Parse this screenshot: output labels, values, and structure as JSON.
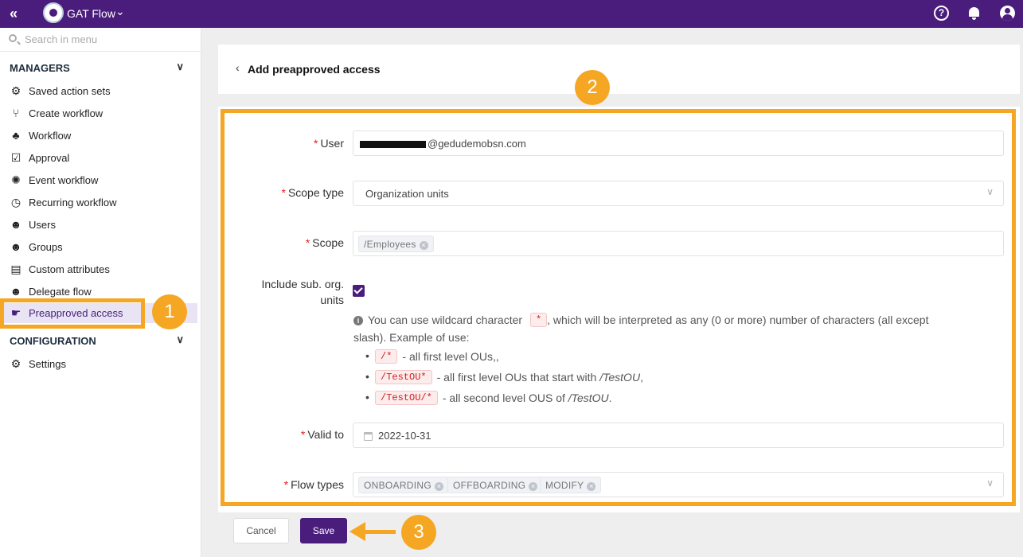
{
  "topbar": {
    "app_title": "GAT Flow",
    "collapse_icon": "double-chevron-left",
    "icons": [
      "help-icon",
      "bell-icon",
      "user-icon"
    ],
    "color": "#4a1d7d"
  },
  "sidebar": {
    "search_placeholder": "Search in menu",
    "managers_label": "MANAGERS",
    "configuration_label": "CONFIGURATION",
    "items": [
      {
        "label": "Saved action sets",
        "icon": "gears-icon"
      },
      {
        "label": "Create workflow",
        "icon": "branch-icon"
      },
      {
        "label": "Workflow",
        "icon": "sitemap-icon"
      },
      {
        "label": "Approval",
        "icon": "checklist-icon"
      },
      {
        "label": "Event workflow",
        "icon": "siren-icon"
      },
      {
        "label": "Recurring workflow",
        "icon": "clock-icon"
      },
      {
        "label": "Users",
        "icon": "user-search-icon"
      },
      {
        "label": "Groups",
        "icon": "users-icon"
      },
      {
        "label": "Custom attributes",
        "icon": "table-icon"
      },
      {
        "label": "Delegate flow",
        "icon": "user-question-icon"
      },
      {
        "label": "Preapproved access",
        "icon": "hand-icon",
        "active": true
      }
    ],
    "config_items": [
      {
        "label": "Settings",
        "icon": "gear-icon"
      }
    ]
  },
  "page": {
    "title": "Add preapproved access"
  },
  "form": {
    "user_label": "User",
    "user_value": "@gedudemobsn.com",
    "scope_type_label": "Scope type",
    "scope_type_value": "Organization units",
    "scope_label": "Scope",
    "scope_tags": [
      "/Employees"
    ],
    "include_sub_label_1": "Include sub. org.",
    "include_sub_label_2": "units",
    "include_sub_checked": true,
    "hint": {
      "text_1": "You can use wildcard character",
      "code_1": "*",
      "text_2": ", which will be interpreted as any (0 or more) number of characters (all except",
      "text_3": "slash). Example of use:",
      "examples": [
        {
          "code": "/*",
          "text": "- all first level OUs,,",
          "italic": ""
        },
        {
          "code": "/TestOU*",
          "text": "- all first level OUs that start with",
          "italic": "/TestOU",
          "suffix": ","
        },
        {
          "code": "/TestOU/*",
          "text": "- all second level OUS of",
          "italic": "/TestOU",
          "suffix": "."
        }
      ]
    },
    "valid_to_label": "Valid to",
    "valid_to_value": "2022-10-31",
    "flow_types_label": "Flow types",
    "flow_types": [
      "ONBOARDING",
      "OFFBOARDING",
      "MODIFY"
    ],
    "required_mark": "*"
  },
  "buttons": {
    "cancel": "Cancel",
    "save": "Save"
  },
  "annotations": {
    "badge_1": "1",
    "badge_2": "2",
    "badge_3": "3",
    "highlight_color": "#f5a623"
  }
}
